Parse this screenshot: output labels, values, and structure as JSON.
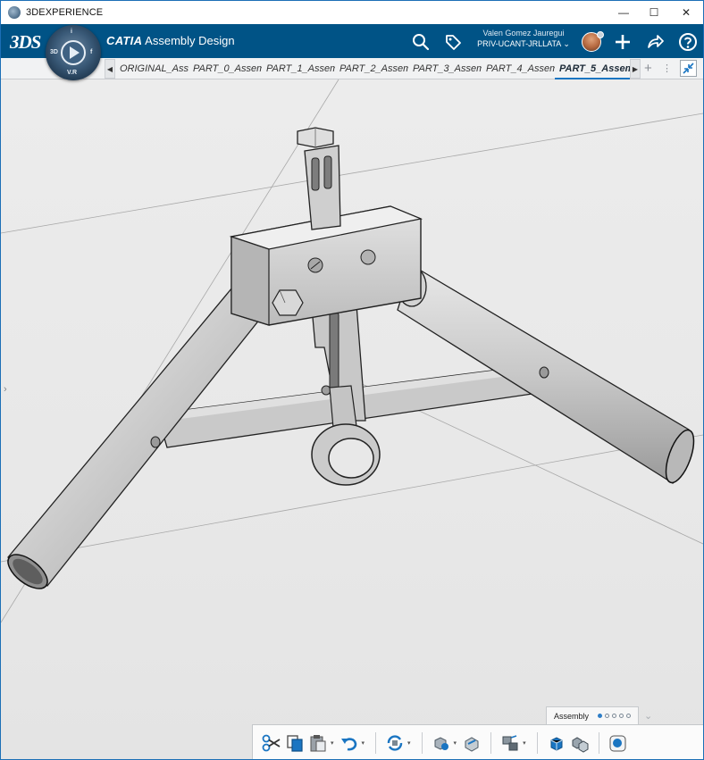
{
  "window": {
    "title": "3DEXPERIENCE",
    "controls": {
      "minimize": "—",
      "maximize": "☐",
      "close": "✕"
    }
  },
  "header": {
    "brand_logo": "3DS",
    "compass_quadrants": [
      "3D",
      "V.R",
      "i",
      "f"
    ],
    "product_brand": "CATIA",
    "product_app": "Assembly Design",
    "user_name": "Valen Gomez Jauregui",
    "credentials": "PRIV-UCANT-JRLLATA",
    "icons": [
      "search-icon",
      "tag-icon",
      "add-icon",
      "share-icon",
      "help-icon"
    ]
  },
  "tabs": {
    "items": [
      {
        "label": "ORIGINAL_Ass"
      },
      {
        "label": "PART_0_Assem"
      },
      {
        "label": "PART_1_Assem"
      },
      {
        "label": "PART_2_Assem"
      },
      {
        "label": "PART_3_Assem"
      },
      {
        "label": "PART_4_Assem"
      },
      {
        "label": "PART_5_Assem"
      }
    ],
    "active_index": 6,
    "add": "+",
    "more": "⋮"
  },
  "viewport": {
    "background_color": "#e8e8e8",
    "model_color": "#c7c7c7",
    "handle": "›"
  },
  "section_bar": {
    "active_section": "Assembly",
    "page_count": 5,
    "active_page": 1
  },
  "action_bar": {
    "tools": [
      "cut-icon",
      "copy-icon",
      "paste-icon",
      "undo-icon",
      "update-icon",
      "engineering-connection-icon",
      "fix-icon",
      "explode-icon",
      "insert-product-icon",
      "insert-existing-icon",
      "rendering-icon"
    ]
  },
  "colors": {
    "app_header": "#005386",
    "active_tab_underline": "#1a75c2",
    "window_border": "#1c6fb6"
  }
}
